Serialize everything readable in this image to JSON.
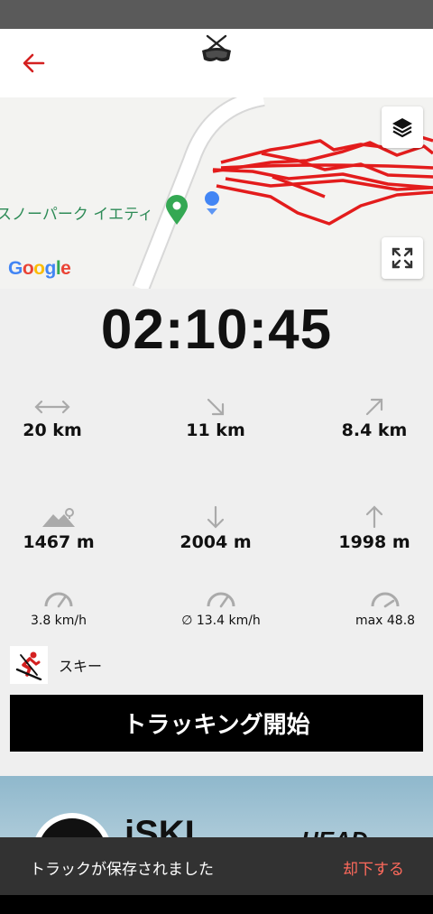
{
  "header": {
    "back_icon": "arrow-left-icon",
    "logo_icon": "ski-goggles-logo-icon"
  },
  "map": {
    "poi_label": "スノーパーク イエティ",
    "attribution": "Google",
    "track_color": "#e31c1c",
    "layers_icon": "layers-icon",
    "fullscreen_icon": "expand-icon"
  },
  "timer": "02:10:45",
  "stats": [
    {
      "icon": "distance-icon",
      "value": "20 km"
    },
    {
      "icon": "downhill-distance-icon",
      "value": "11 km"
    },
    {
      "icon": "uphill-distance-icon",
      "value": "8.4 km"
    },
    {
      "icon": "altitude-icon",
      "value": "1467 m"
    },
    {
      "icon": "descent-icon",
      "value": "2004 m"
    },
    {
      "icon": "ascent-icon",
      "value": "1998 m"
    },
    {
      "icon": "speed-icon",
      "value": "3.8 km/h"
    },
    {
      "icon": "avg-speed-icon",
      "value": "∅ 13.4 km/h"
    },
    {
      "icon": "max-speed-icon",
      "value": "max 48.8"
    }
  ],
  "activity": {
    "icon": "skier-icon",
    "label": "スキー"
  },
  "start_button": "トラッキング開始",
  "banner": {
    "brand1": "iSKI",
    "brand2": "HEAD"
  },
  "snackbar": {
    "message": "トラックが保存されました",
    "action": "却下する"
  },
  "colors": {
    "accent": "#d42020",
    "button_bg": "#000000",
    "snackbar_bg": "#323232",
    "snackbar_action": "#ff6a5c"
  }
}
